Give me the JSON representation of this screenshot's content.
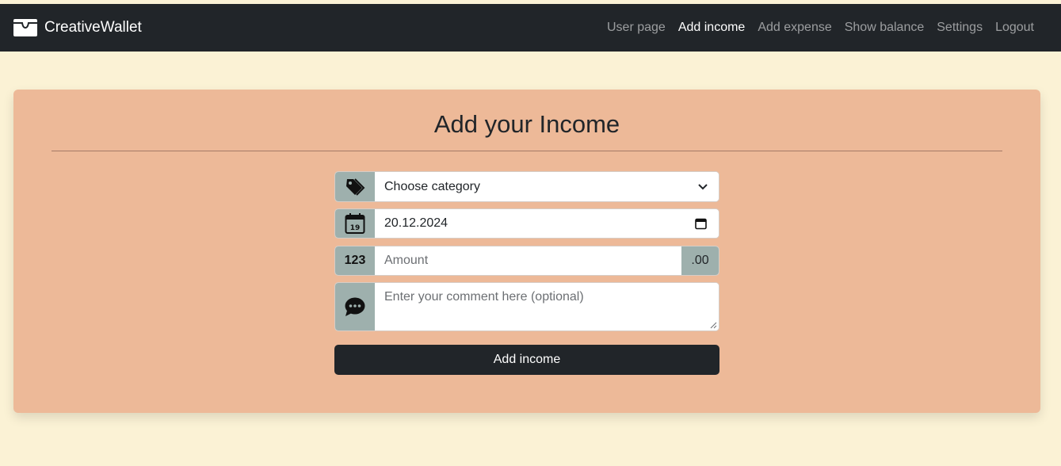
{
  "brand": {
    "name": "CreativeWallet",
    "icon": "wallet-icon"
  },
  "nav": {
    "items": [
      {
        "label": "User page",
        "active": false
      },
      {
        "label": "Add income",
        "active": true
      },
      {
        "label": "Add expense",
        "active": false
      },
      {
        "label": "Show balance",
        "active": false
      },
      {
        "label": "Settings",
        "active": false
      },
      {
        "label": "Logout",
        "active": false
      }
    ]
  },
  "page": {
    "title": "Add your Income"
  },
  "form": {
    "category": {
      "value": "Choose category",
      "icon": "tags-icon"
    },
    "date": {
      "value": "20.12.2024",
      "icon": "calendar-icon",
      "icon_text": "19"
    },
    "amount": {
      "placeholder": "Amount",
      "prefix": "123",
      "suffix": ".00"
    },
    "comment": {
      "placeholder": "Enter your comment here (optional)",
      "icon": "chat-icon"
    },
    "submit_label": "Add income"
  },
  "colors": {
    "navbar": "#212529",
    "background": "#fbf2d5",
    "card": "#edb998",
    "addon": "#9eb0ad",
    "button": "#212529"
  }
}
